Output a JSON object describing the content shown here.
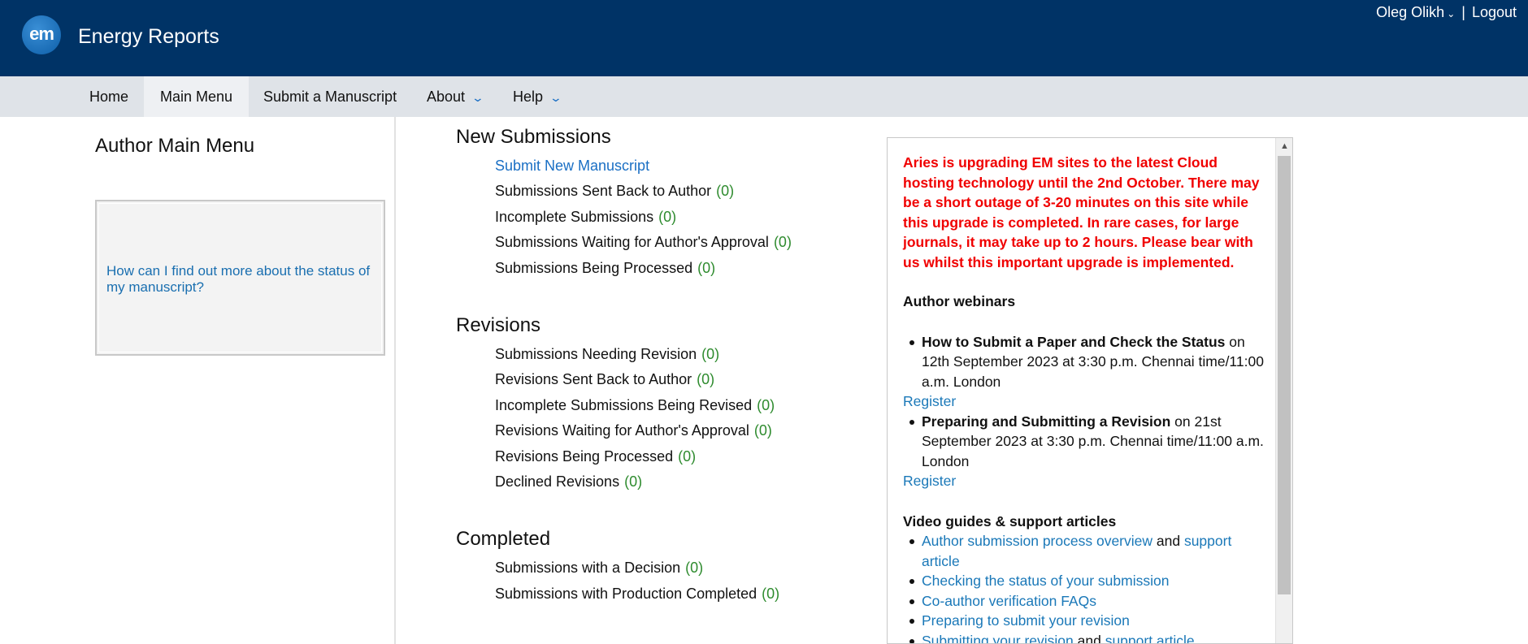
{
  "header": {
    "logo_text": "em",
    "journal_title": "Energy Reports",
    "user_name": "Oleg Olikh",
    "separator": "|",
    "logout_label": "Logout"
  },
  "nav": {
    "items": [
      {
        "label": "Home"
      },
      {
        "label": "Main Menu"
      },
      {
        "label": "Submit a Manuscript"
      },
      {
        "label": "About"
      },
      {
        "label": "Help"
      }
    ]
  },
  "left": {
    "heading": "Author Main Menu",
    "faq_link": "How can I find out more about the status of my manuscript?"
  },
  "sections": {
    "new": {
      "title": "New Submissions",
      "submit_link": "Submit New Manuscript",
      "items": [
        {
          "label": "Submissions Sent Back to Author",
          "count": "(0)"
        },
        {
          "label": "Incomplete Submissions",
          "count": "(0)"
        },
        {
          "label": "Submissions Waiting for Author's Approval",
          "count": "(0)"
        },
        {
          "label": "Submissions Being Processed",
          "count": "(0)"
        }
      ]
    },
    "revisions": {
      "title": "Revisions",
      "items": [
        {
          "label": "Submissions Needing Revision",
          "count": "(0)"
        },
        {
          "label": "Revisions Sent Back to Author",
          "count": "(0)"
        },
        {
          "label": "Incomplete Submissions Being Revised",
          "count": "(0)"
        },
        {
          "label": "Revisions Waiting for Author's Approval",
          "count": "(0)"
        },
        {
          "label": "Revisions Being Processed",
          "count": "(0)"
        },
        {
          "label": "Declined Revisions",
          "count": "(0)"
        }
      ]
    },
    "completed": {
      "title": "Completed",
      "items": [
        {
          "label": "Submissions with a Decision",
          "count": "(0)"
        },
        {
          "label": "Submissions with Production Completed",
          "count": "(0)"
        }
      ]
    }
  },
  "notice": {
    "warning": "Aries is upgrading EM sites to the latest Cloud hosting technology until the 2nd October. There may be a short outage of 3-20 minutes on this site while this upgrade is completed. In rare cases, for large journals, it may take up to 2 hours. Please bear with us whilst this important upgrade is implemented.",
    "webinars_heading": "Author webinars",
    "webinar1_title": "How to Submit a Paper and Check the Status",
    "webinar1_text": " on 12th September 2023 at 3:30 p.m. Chennai time/11:00 a.m. London",
    "webinar2_title": "Preparing and Submitting a Revision",
    "webinar2_text": " on 21st September 2023 at 3:30 p.m. Chennai time/11:00 a.m. London",
    "register_label": "Register",
    "guides_heading": "Video guides & support articles",
    "guide1": "Author submission process overview",
    "and": " and ",
    "support_article": "support article",
    "guide2": "Checking the status of your submission",
    "guide3": "Co-author verification FAQs",
    "guide4": "Preparing to submit your revision",
    "guide5": "Submitting your revision"
  },
  "colors": {
    "header_bg": "#003366",
    "nav_bg": "#dfe3e8",
    "link_blue": "#1a6fc4",
    "count_green": "#2e8b2e",
    "warning_red": "#f00000"
  }
}
